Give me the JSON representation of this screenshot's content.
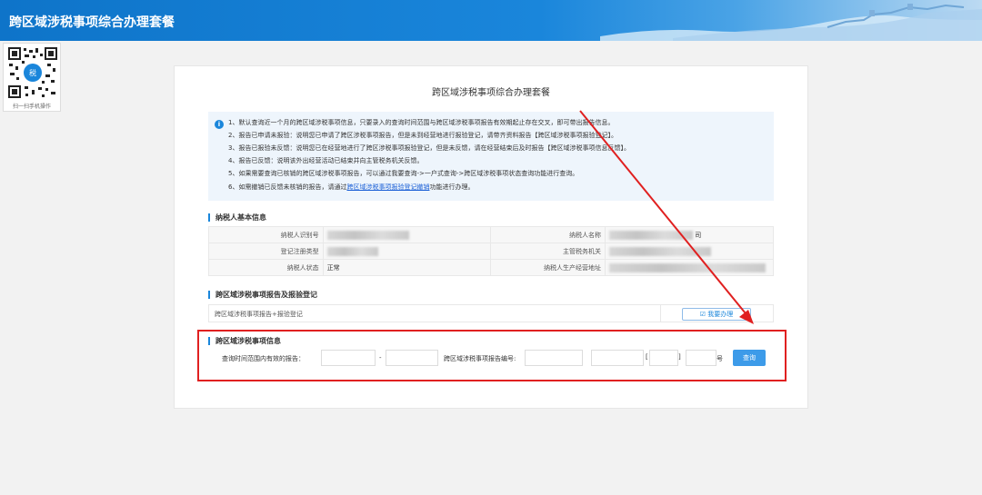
{
  "header": {
    "title": "跨区域涉税事项综合办理套餐"
  },
  "qr": {
    "label": "扫一扫手机操作"
  },
  "panel": {
    "title": "跨区域涉税事项综合办理套餐"
  },
  "notice": {
    "lines": [
      "1、默认查询近一个月的跨区域涉税事项信息，只要录入的查询时间范围与跨区域涉税事项报告有效期起止存在交叉，即可带出报告信息。",
      "2、报告已申请未报验：说明您已申请了跨区涉税事项报告，但是未到经营地进行报验登记，请带齐资料报告【跨区域涉税事项报验登记】。",
      "3、报告已报验未反馈：说明您已在经营地进行了跨区涉税事项报验登记，但是未反馈，请在经营结束后及时报告【跨区域涉税事项信息反馈】。",
      "4、报告已反馈：说明该外出经营活动已结束并向主管税务机关反馈。",
      "5、如果需要查询已核销的跨区域涉税事项报告，可以通过我要查询->一户式查询->跨区域涉税事项状态查询功能进行查询。"
    ],
    "line6_prefix": "6、如需撤销已反馈未核销的报告，请通过",
    "line6_link": "跨区域涉税事项报验登记撤销",
    "line6_suffix": "功能进行办理。"
  },
  "taxpayer_section": {
    "title": "纳税人基本信息",
    "rows": [
      {
        "label_left": "纳税人识别号",
        "label_right": "纳税人名称",
        "right_suffix": "司"
      },
      {
        "label_left": "登记注册类型",
        "label_right": "主管税务机关"
      },
      {
        "label_left": "纳税人状态",
        "value_left": "正常",
        "label_right": "纳税人生产经营地址"
      }
    ]
  },
  "report_section": {
    "title": "跨区域涉税事项报告及报验登记",
    "row_text": "跨区域涉税事项报告+报验登记",
    "button_label": "☑ 我要办理"
  },
  "query_section": {
    "title": "跨区域涉税事项信息",
    "range_label": "查询时间范围内有效的报告：",
    "range_sep": "-",
    "number_label": "跨区域涉税事项报告编号:",
    "bracket_open": "[",
    "bracket_close": "]",
    "hao": "号",
    "query_button": "查询"
  },
  "colors": {
    "accent": "#1a86db",
    "annotation": "#e02020"
  }
}
